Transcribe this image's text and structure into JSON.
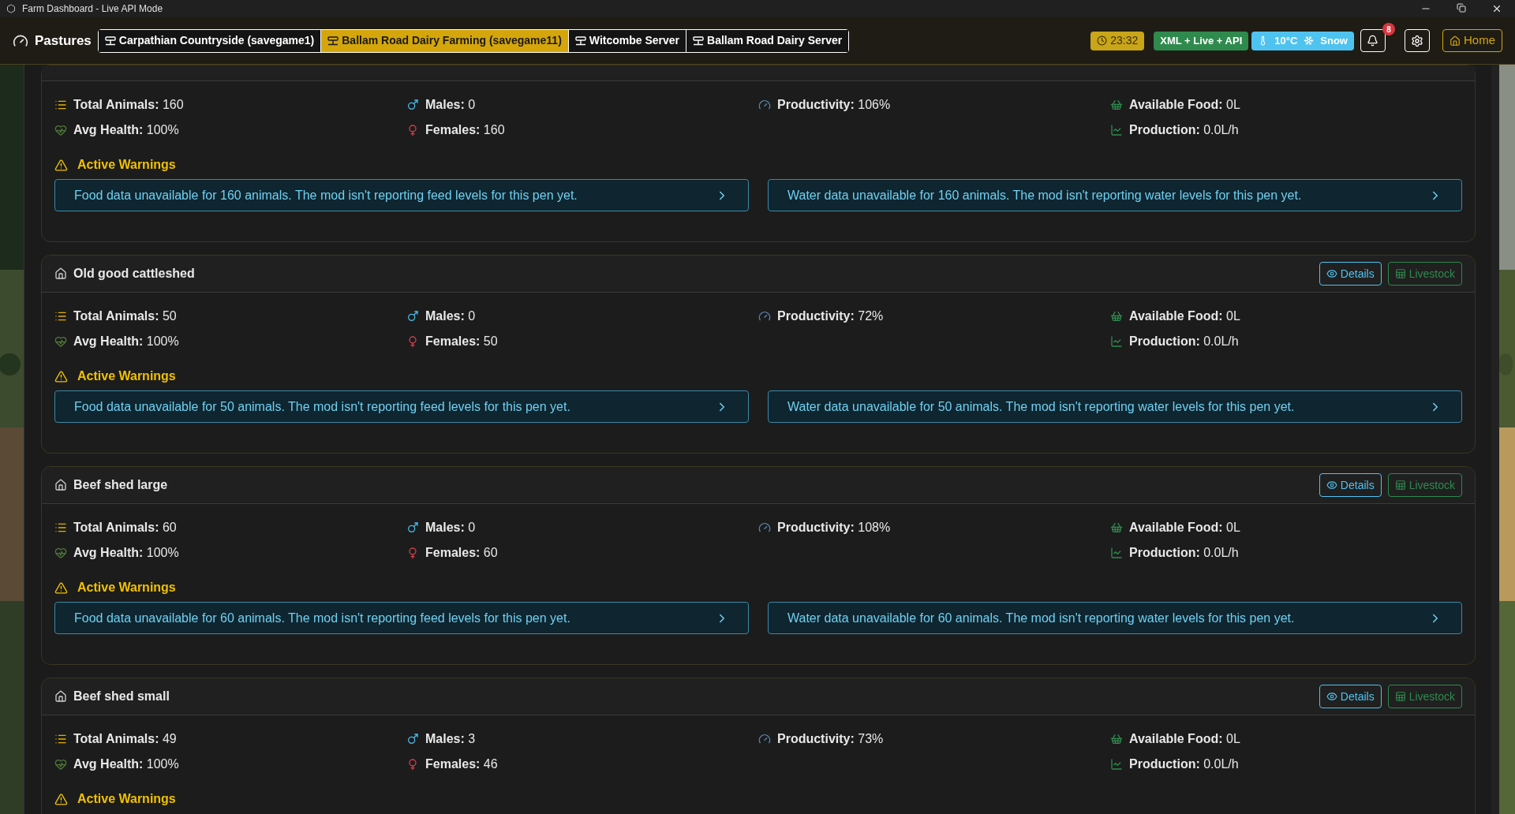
{
  "window": {
    "title": "Farm Dashboard - Live API Mode"
  },
  "nav": {
    "title": "Pastures",
    "tabs": [
      {
        "label": "Carpathian Countryside (savegame1)",
        "selected": false
      },
      {
        "label": "Ballam Road Dairy Farming (savegame11)",
        "selected": true
      },
      {
        "label": "Witcombe Server",
        "selected": false
      },
      {
        "label": "Ballam Road Dairy Server",
        "selected": false
      }
    ],
    "time": "23:32",
    "mode": "XML + Live + API",
    "temperature": "10°C",
    "weather": "Snow",
    "notification_count": "8",
    "home": "Home"
  },
  "pens": [
    {
      "columns": [
        [
          {
            "kind": "total",
            "label": "Total Animals:",
            "value": "160"
          },
          {
            "kind": "health",
            "label": "Avg Health:",
            "value": "100%"
          }
        ],
        [
          {
            "kind": "males",
            "label": "Males:",
            "value": "0"
          },
          {
            "kind": "females",
            "label": "Females:",
            "value": "160"
          }
        ],
        [
          {
            "kind": "productivity",
            "label": "Productivity:",
            "value": "106%"
          }
        ],
        [
          {
            "kind": "food",
            "label": "Available Food:",
            "value": "0L"
          },
          {
            "kind": "production",
            "label": "Production:",
            "value": "0.0L/h"
          }
        ]
      ],
      "warnings_title": "Active Warnings",
      "warnings": [
        "Food data unavailable for 160 animals. The mod isn't reporting feed levels for this pen yet.",
        "Water data unavailable for 160 animals. The mod isn't reporting water levels for this pen yet."
      ]
    },
    {
      "name": "Old good cattleshed",
      "buttons": [
        "Details",
        "Livestock"
      ],
      "columns": [
        [
          {
            "kind": "total",
            "label": "Total Animals:",
            "value": "50"
          },
          {
            "kind": "health",
            "label": "Avg Health:",
            "value": "100%"
          }
        ],
        [
          {
            "kind": "males",
            "label": "Males:",
            "value": "0"
          },
          {
            "kind": "females",
            "label": "Females:",
            "value": "50"
          }
        ],
        [
          {
            "kind": "productivity",
            "label": "Productivity:",
            "value": "72%"
          }
        ],
        [
          {
            "kind": "food",
            "label": "Available Food:",
            "value": "0L"
          },
          {
            "kind": "production",
            "label": "Production:",
            "value": "0.0L/h"
          }
        ]
      ],
      "warnings_title": "Active Warnings",
      "warnings": [
        "Food data unavailable for 50 animals. The mod isn't reporting feed levels for this pen yet.",
        "Water data unavailable for 50 animals. The mod isn't reporting water levels for this pen yet."
      ]
    },
    {
      "name": "Beef shed large",
      "buttons": [
        "Details",
        "Livestock"
      ],
      "columns": [
        [
          {
            "kind": "total",
            "label": "Total Animals:",
            "value": "60"
          },
          {
            "kind": "health",
            "label": "Avg Health:",
            "value": "100%"
          }
        ],
        [
          {
            "kind": "males",
            "label": "Males:",
            "value": "0"
          },
          {
            "kind": "females",
            "label": "Females:",
            "value": "60"
          }
        ],
        [
          {
            "kind": "productivity",
            "label": "Productivity:",
            "value": "108%"
          }
        ],
        [
          {
            "kind": "food",
            "label": "Available Food:",
            "value": "0L"
          },
          {
            "kind": "production",
            "label": "Production:",
            "value": "0.0L/h"
          }
        ]
      ],
      "warnings_title": "Active Warnings",
      "warnings": [
        "Food data unavailable for 60 animals. The mod isn't reporting feed levels for this pen yet.",
        "Water data unavailable for 60 animals. The mod isn't reporting water levels for this pen yet."
      ]
    },
    {
      "name": "Beef shed small",
      "buttons": [
        "Details",
        "Livestock"
      ],
      "columns": [
        [
          {
            "kind": "total",
            "label": "Total Animals:",
            "value": "49"
          },
          {
            "kind": "health",
            "label": "Avg Health:",
            "value": "100%"
          }
        ],
        [
          {
            "kind": "males",
            "label": "Males:",
            "value": "3"
          },
          {
            "kind": "females",
            "label": "Females:",
            "value": "46"
          }
        ],
        [
          {
            "kind": "productivity",
            "label": "Productivity:",
            "value": "73%"
          }
        ],
        [
          {
            "kind": "food",
            "label": "Available Food:",
            "value": "0L"
          },
          {
            "kind": "production",
            "label": "Production:",
            "value": "0.0L/h"
          }
        ]
      ],
      "warnings_title": "Active Warnings"
    }
  ]
}
